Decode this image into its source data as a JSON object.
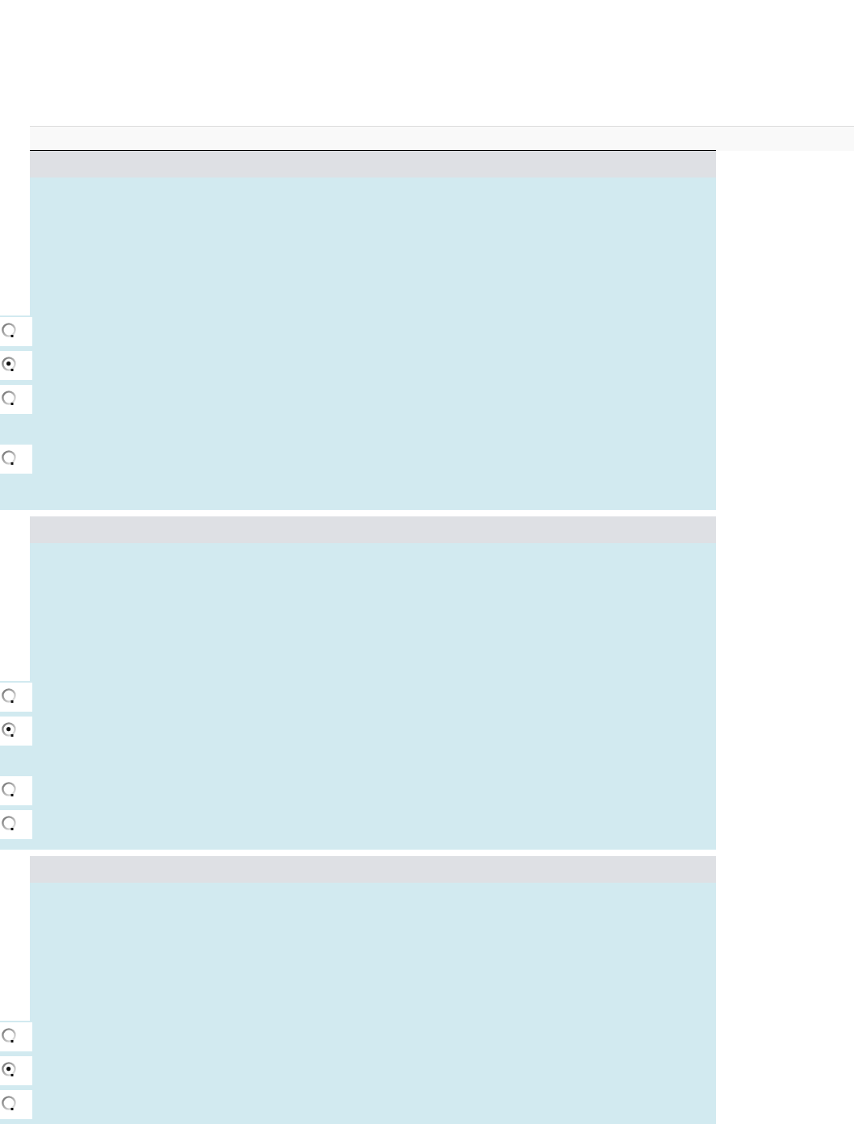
{
  "questions": [
    {
      "options": [
        {
          "selected": false,
          "kind": "short"
        },
        {
          "selected": true,
          "kind": "short"
        },
        {
          "selected": false,
          "kind": "long"
        },
        {
          "selected": false,
          "kind": "long"
        }
      ]
    },
    {
      "options": [
        {
          "selected": false,
          "kind": "short"
        },
        {
          "selected": true,
          "kind": "long"
        },
        {
          "selected": false,
          "kind": "short"
        },
        {
          "selected": false,
          "kind": "short"
        }
      ]
    },
    {
      "options": [
        {
          "selected": false,
          "kind": "short"
        },
        {
          "selected": true,
          "kind": "short"
        },
        {
          "selected": false,
          "kind": "short"
        }
      ]
    }
  ]
}
